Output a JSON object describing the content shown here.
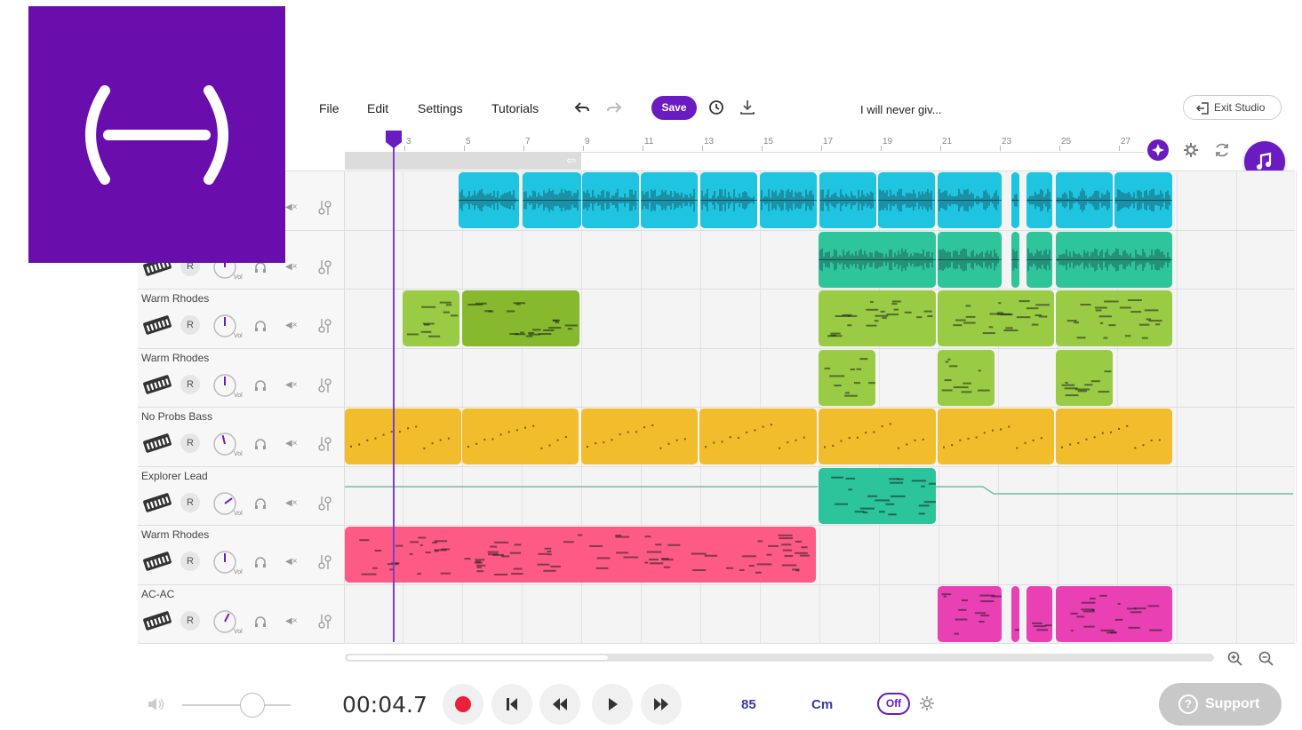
{
  "menu": {
    "file": "File",
    "edit": "Edit",
    "settings": "Settings",
    "tutorials": "Tutorials",
    "save_label": "Save",
    "project_title": "I will never giv...",
    "exit_label": "Exit Studio"
  },
  "ruler": {
    "bars": [
      "3",
      "5",
      "7",
      "9",
      "11",
      "13",
      "15",
      "17",
      "19",
      "21",
      "23",
      "25",
      "27"
    ]
  },
  "tracks": [
    {
      "name": "",
      "volume_level": 0.5
    },
    {
      "name": "",
      "volume_level": 0.5
    },
    {
      "name": "Warm Rhodes",
      "volume_level": 0.5
    },
    {
      "name": "Warm Rhodes",
      "volume_level": 0.5
    },
    {
      "name": "No Probs Bass",
      "volume_level": 0.45
    },
    {
      "name": "Explorer Lead",
      "volume_level": 0.7
    },
    {
      "name": "Warm Rhodes",
      "volume_level": 0.5
    },
    {
      "name": "AC-AC",
      "volume_level": 0.6
    }
  ],
  "track_controls": {
    "record_label": "R",
    "vol_label": "Vol",
    "mute_label": "◀×"
  },
  "transport": {
    "time": "00:04.7",
    "tempo": "85",
    "key": "Cm",
    "metronome": "Off",
    "support_label": "Support",
    "master_volume_level": 0.65
  },
  "colors": {
    "brand": "#6a1bc2",
    "logo_bg": "#6a0dad",
    "audio_clip": "#1ec4e0",
    "audio_clip2": "#2fc59a",
    "rhodes_light": "#9acb45",
    "rhodes_dark": "#86b92e",
    "bass": "#f2bd2d",
    "lead": "#2cc49b",
    "rhodes_pink": "#fd5b86",
    "acac": "#e940b4",
    "record": "#e9213a",
    "support": "#c8c8c8"
  }
}
